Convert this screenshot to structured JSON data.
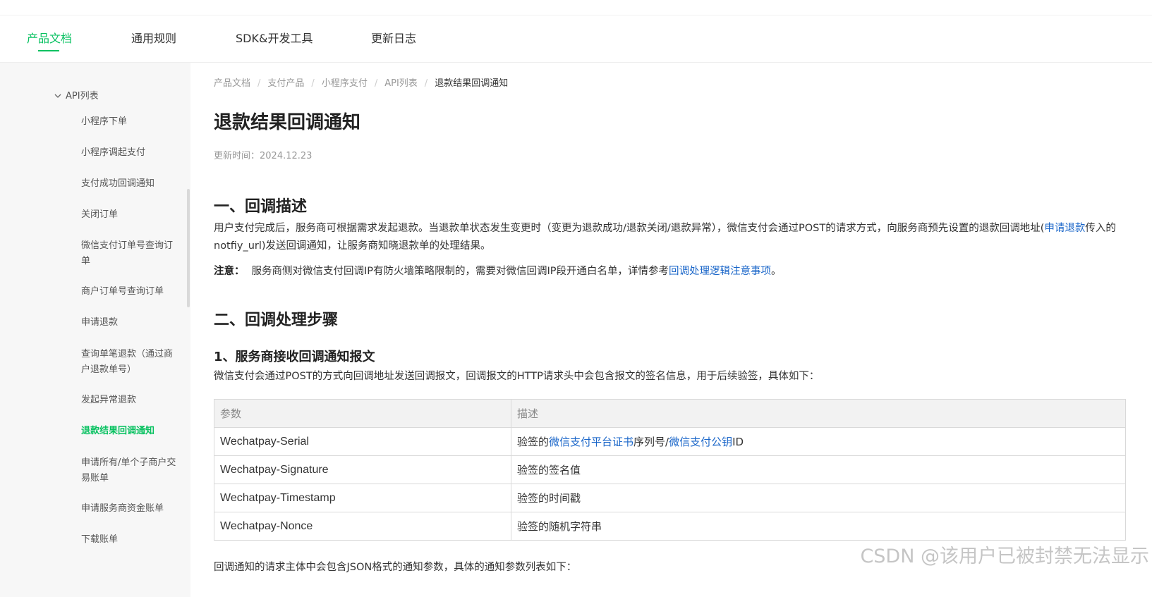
{
  "topnav": {
    "tabs": [
      "产品文档",
      "通用规则",
      "SDK&开发工具",
      "更新日志"
    ],
    "active": "产品文档"
  },
  "sidebar": {
    "group": "API列表",
    "items": [
      "小程序下单",
      "小程序调起支付",
      "支付成功回调通知",
      "关闭订单",
      "微信支付订单号查询订单",
      "商户订单号查询订单",
      "申请退款",
      "查询单笔退款（通过商户退款单号）",
      "发起异常退款",
      "退款结果回调通知",
      "申请所有/单个子商户交易账单",
      "申请服务商资金账单",
      "下载账单"
    ],
    "active": "退款结果回调通知"
  },
  "breadcrumb": [
    "产品文档",
    "支付产品",
    "小程序支付",
    "API列表",
    "退款结果回调通知"
  ],
  "page": {
    "title": "退款结果回调通知",
    "updated": "更新时间：2024.12.23",
    "section1": {
      "heading": "一、回调描述",
      "p1_before": "用户支付完成后，服务商可根据需求发起退款。当退款单状态发生变更时（变更为退款成功/退款关闭/退款异常），微信支付会通过POST的请求方式，向服务商预先设置的退款回调地址(",
      "p1_link": "申请退款",
      "p1_after": "传入的notfiy_url)发送回调通知，让服务商知晓退款单的处理结果。",
      "note_label": "注意：",
      "note_before": "服务商侧对微信支付回调IP有防火墙策略限制的，需要对微信回调IP段开通白名单，详情参考",
      "note_link": "回调处理逻辑注意事项",
      "note_after": "。"
    },
    "section2": {
      "heading": "二、回调处理步骤",
      "sub1": "1、服务商接收回调通知报文",
      "sub1_desc": "微信支付会通过POST的方式向回调地址发送回调报文，回调报文的HTTP请求头中会包含报文的签名信息，用于后续验签，具体如下：",
      "table": {
        "headers": [
          "参数",
          "描述"
        ],
        "rows": [
          {
            "param": "Wechatpay-Serial",
            "desc_before": "验签的",
            "link1": "微信支付平台证书",
            "desc_mid": "序列号/",
            "link2": "微信支付公钥",
            "desc_after": "ID"
          },
          {
            "param": "Wechatpay-Signature",
            "desc_before": "验签的签名值",
            "link1": "",
            "desc_mid": "",
            "link2": "",
            "desc_after": ""
          },
          {
            "param": "Wechatpay-Timestamp",
            "desc_before": "验签的时间戳",
            "link1": "",
            "desc_mid": "",
            "link2": "",
            "desc_after": ""
          },
          {
            "param": "Wechatpay-Nonce",
            "desc_before": "验签的随机字符串",
            "link1": "",
            "desc_mid": "",
            "link2": "",
            "desc_after": ""
          }
        ]
      },
      "footer_text": "回调通知的请求主体中会包含JSON格式的通知参数，具体的通知参数列表如下："
    }
  },
  "watermark": "CSDN @该用户已被封禁无法显示",
  "colors": {
    "accent": "#07c160",
    "link": "#1a66c9"
  }
}
